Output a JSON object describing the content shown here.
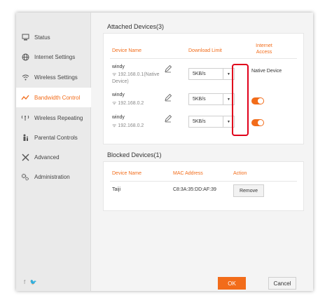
{
  "sidebar": {
    "items": [
      {
        "label": "Status",
        "icon": "status-icon"
      },
      {
        "label": "Internet Settings",
        "icon": "globe-icon"
      },
      {
        "label": "Wireless Settings",
        "icon": "wifi-icon"
      },
      {
        "label": "Bandwidth Control",
        "icon": "bandwidth-icon",
        "active": true
      },
      {
        "label": "Wireless Repeating",
        "icon": "repeater-icon"
      },
      {
        "label": "Parental Controls",
        "icon": "parental-icon"
      },
      {
        "label": "Advanced",
        "icon": "tools-icon"
      },
      {
        "label": "Administration",
        "icon": "gears-icon"
      }
    ],
    "social": "f  🐦"
  },
  "attached": {
    "title": "Attached Devices(3)",
    "headers": {
      "device": "Device Name",
      "download": "Download Limit",
      "internet": "Internet Access"
    },
    "rows": [
      {
        "name": "windy",
        "ip": "192.168.0.1(Native Device)",
        "limit": "5KB/s",
        "access": "Native Device"
      },
      {
        "name": "windy",
        "ip": "192.168.0.2",
        "limit": "5KB/s",
        "access": "on"
      },
      {
        "name": "windy",
        "ip": "192.168.0.2",
        "limit": "5KB/s",
        "access": "on"
      }
    ]
  },
  "blocked": {
    "title": "Blocked Devices(1)",
    "headers": {
      "device": "Device Name",
      "mac": "MAC Address",
      "action": "Action"
    },
    "rows": [
      {
        "name": "Taiji",
        "mac": "C8:3A:35:DD:AF:39",
        "action": "Remove"
      }
    ]
  },
  "footer": {
    "ok": "OK",
    "cancel": "Cancel"
  },
  "colors": {
    "accent": "#f26c1a",
    "highlight": "#e0001b"
  }
}
